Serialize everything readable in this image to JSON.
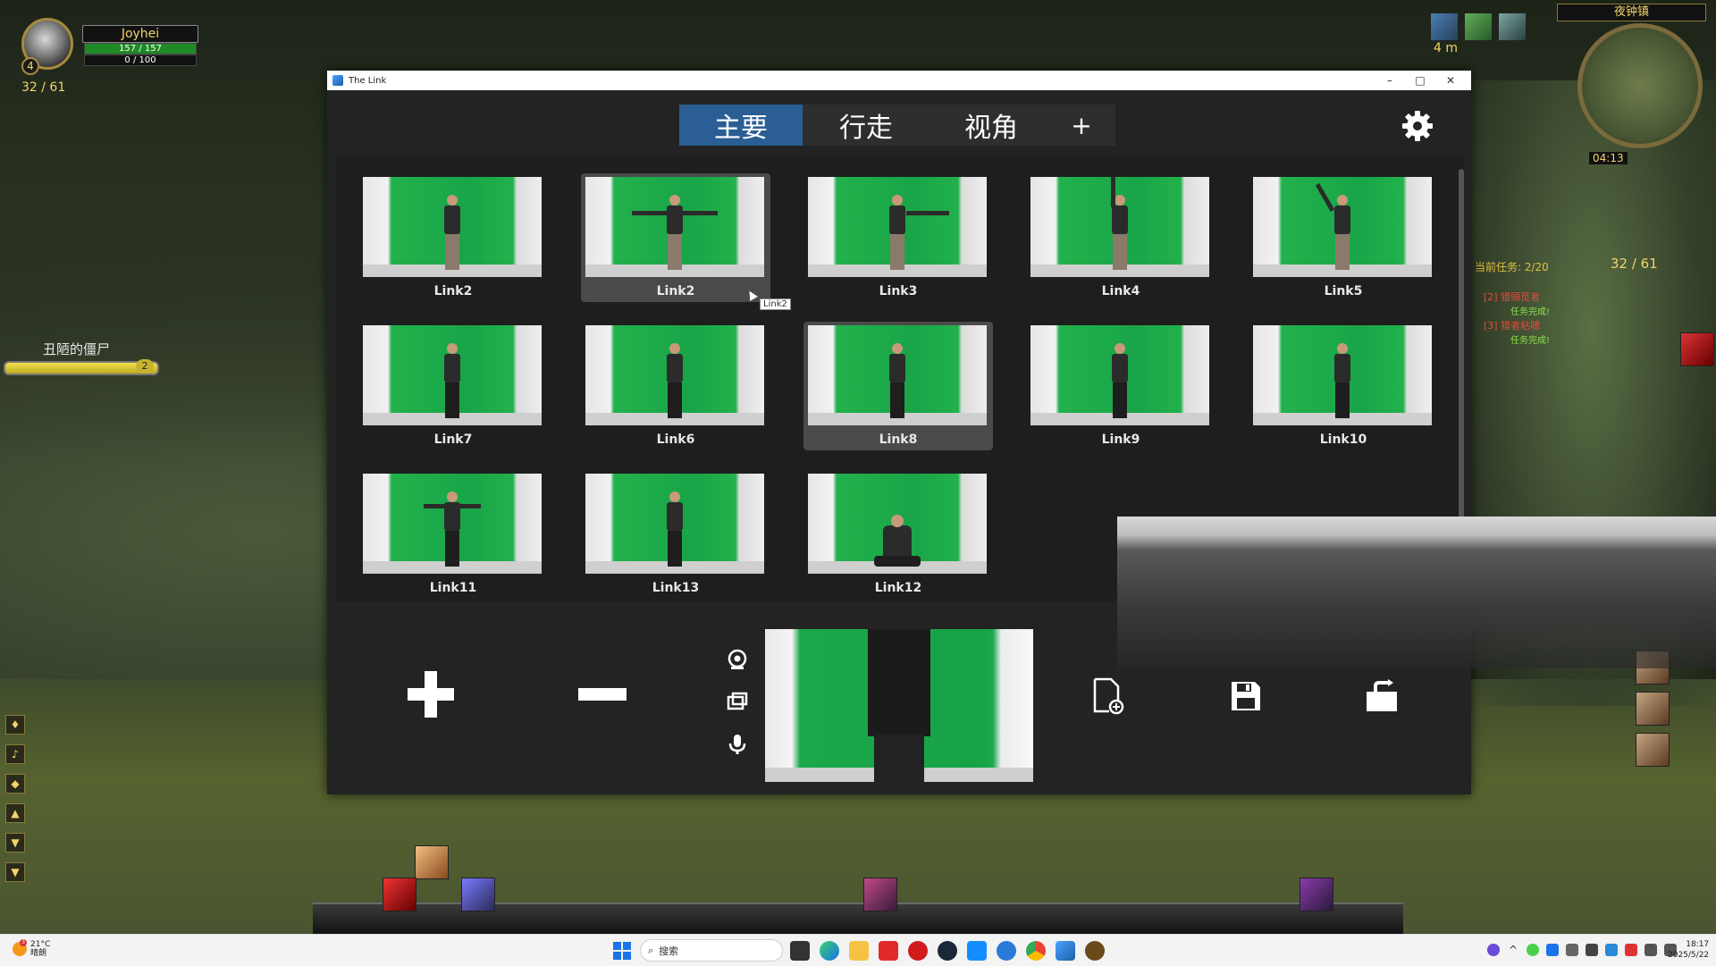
{
  "game": {
    "player_name": "Joyhei",
    "player_level": "4",
    "hp_text": "157 / 157",
    "mp_text": "0 / 100",
    "party_count": "32 / 61",
    "enemy_name": "丑陋的僵尸",
    "enemy_level": "2",
    "minimap_zone": "夜钟镇",
    "clock": "04:13",
    "distance": "4 m",
    "quest_title": "当前任务: 2/20",
    "quest_ratio": "32 / 61",
    "quest_lines": [
      "[2] 猎頭觅者",
      "[3] 猎者粘聰"
    ],
    "quest_subs": [
      "任务完成!",
      "任务完成!"
    ]
  },
  "window": {
    "title": "The Link",
    "controls": {
      "minimize": "–",
      "maximize": "□",
      "close": "✕"
    }
  },
  "tabs": [
    {
      "label": "主要",
      "active": true
    },
    {
      "label": "行走",
      "active": false
    },
    {
      "label": "视角",
      "active": false
    }
  ],
  "tab_add": "+",
  "tiles": [
    {
      "label": "Link2",
      "selected": false,
      "pose": "a",
      "legs": "light"
    },
    {
      "label": "Link2",
      "selected": true,
      "pose": "b",
      "legs": "light"
    },
    {
      "label": "Link3",
      "selected": false,
      "pose": "c",
      "legs": "light"
    },
    {
      "label": "Link4",
      "selected": false,
      "pose": "d",
      "legs": "light"
    },
    {
      "label": "Link5",
      "selected": false,
      "pose": "e",
      "legs": "light"
    },
    {
      "label": "Link7",
      "selected": false,
      "pose": "a",
      "legs": "dark"
    },
    {
      "label": "Link6",
      "selected": false,
      "pose": "a",
      "legs": "dark"
    },
    {
      "label": "Link8",
      "selected": true,
      "pose": "a",
      "legs": "dark"
    },
    {
      "label": "Link9",
      "selected": false,
      "pose": "a",
      "legs": "dark"
    },
    {
      "label": "Link10",
      "selected": false,
      "pose": "a",
      "legs": "dark"
    },
    {
      "label": "Link11",
      "selected": false,
      "pose": "b",
      "legs": "dark"
    },
    {
      "label": "Link13",
      "selected": false,
      "pose": "a",
      "legs": "dark"
    },
    {
      "label": "Link12",
      "selected": false,
      "pose": "f",
      "legs": "dark"
    }
  ],
  "tooltip": "Link2",
  "toolbar": {
    "add_icon": "plus-icon",
    "remove_icon": "minus-icon",
    "side_icons": [
      "webcam-icon",
      "screen-icon",
      "microphone-icon"
    ],
    "right_icons": [
      "new-file-icon",
      "save-icon",
      "export-icon"
    ]
  },
  "colors": {
    "accent": "#2a5e94",
    "window_bg": "#232323",
    "panel_bg": "#1e1e1e",
    "selected_tile": "#4a4a4a",
    "green_screen": "#19a548"
  },
  "taskbar": {
    "weather_temp": "21°C",
    "weather_text": "晴朗",
    "weather_badge": "3",
    "search_placeholder": "搜索",
    "time": "18:17",
    "date": "2025/5/22"
  }
}
